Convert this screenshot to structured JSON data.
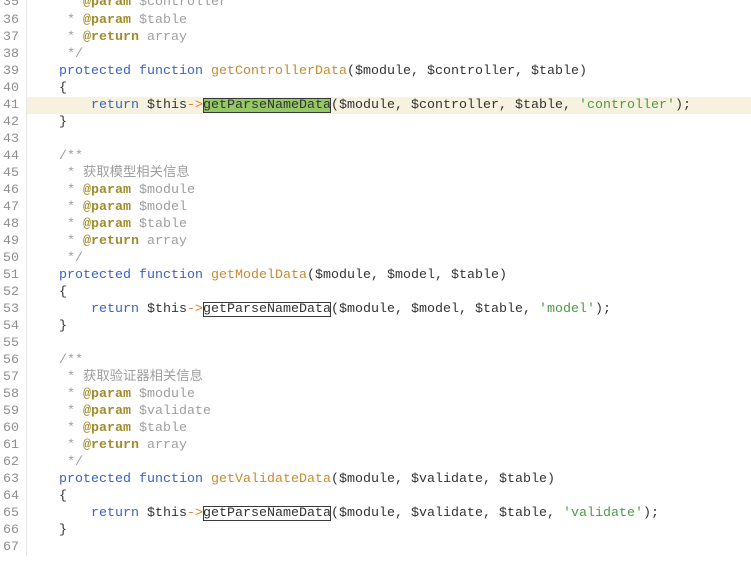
{
  "editor": {
    "colors": {
      "background": "#ffffff",
      "current_line": "#f6f2df",
      "keyword": "#3a63c4",
      "function_name": "#c8892f",
      "method_call": "#333333",
      "variable": "#333333",
      "operator": "#e07a2c",
      "punctuation": "#333333",
      "string": "#4a9c45",
      "comment": "#9e9e9e",
      "doc_tag": "#a18c2c",
      "line_number": "#8e8e8e",
      "gutter_border": "#e6e6e6",
      "selection": "#93c865",
      "selection_border": "#3a3a3a"
    },
    "lines": [
      {
        "n": "35",
        "tokens": [
          {
            "ws": "     "
          },
          {
            "cm": "* "
          },
          {
            "tag": "@param"
          },
          {
            "cm": " $controller"
          }
        ]
      },
      {
        "n": "36",
        "tokens": [
          {
            "ws": "     "
          },
          {
            "cm": "* "
          },
          {
            "tag": "@param"
          },
          {
            "cm": " $table"
          }
        ]
      },
      {
        "n": "37",
        "tokens": [
          {
            "ws": "     "
          },
          {
            "cm": "* "
          },
          {
            "tag": "@return"
          },
          {
            "cm": " array"
          }
        ]
      },
      {
        "n": "38",
        "tokens": [
          {
            "ws": "     "
          },
          {
            "cm": "*/"
          }
        ]
      },
      {
        "n": "39",
        "tokens": [
          {
            "ws": "    "
          },
          {
            "kw": "protected"
          },
          {
            "ws": " "
          },
          {
            "kw": "function"
          },
          {
            "ws": " "
          },
          {
            "fn": "getControllerData"
          },
          {
            "punc": "("
          },
          {
            "var": "$module"
          },
          {
            "punc": ", "
          },
          {
            "var": "$controller"
          },
          {
            "punc": ", "
          },
          {
            "var": "$table"
          },
          {
            "punc": ")"
          }
        ]
      },
      {
        "n": "40",
        "tokens": [
          {
            "ws": "    "
          },
          {
            "punc": "{"
          }
        ]
      },
      {
        "n": "41",
        "current": true,
        "selected": 5,
        "tokens": [
          {
            "ws": "        "
          },
          {
            "kw": "return"
          },
          {
            "ws": " "
          },
          {
            "var": "$this"
          },
          {
            "op": "->"
          },
          {
            "call": "getParseNameData"
          },
          {
            "punc": "("
          },
          {
            "var": "$module"
          },
          {
            "punc": ", "
          },
          {
            "var": "$controller"
          },
          {
            "punc": ", "
          },
          {
            "var": "$table"
          },
          {
            "punc": ", "
          },
          {
            "str": "'controller'"
          },
          {
            "punc": ");"
          }
        ]
      },
      {
        "n": "42",
        "tokens": [
          {
            "ws": "    "
          },
          {
            "punc": "}"
          }
        ]
      },
      {
        "n": "43",
        "tokens": []
      },
      {
        "n": "44",
        "tokens": [
          {
            "ws": "    "
          },
          {
            "cm": "/**"
          }
        ]
      },
      {
        "n": "45",
        "tokens": [
          {
            "ws": "     "
          },
          {
            "cm": "* 获取模型相关信息"
          }
        ]
      },
      {
        "n": "46",
        "tokens": [
          {
            "ws": "     "
          },
          {
            "cm": "* "
          },
          {
            "tag": "@param"
          },
          {
            "cm": " $module"
          }
        ]
      },
      {
        "n": "47",
        "tokens": [
          {
            "ws": "     "
          },
          {
            "cm": "* "
          },
          {
            "tag": "@param"
          },
          {
            "cm": " $model"
          }
        ]
      },
      {
        "n": "48",
        "tokens": [
          {
            "ws": "     "
          },
          {
            "cm": "* "
          },
          {
            "tag": "@param"
          },
          {
            "cm": " $table"
          }
        ]
      },
      {
        "n": "49",
        "tokens": [
          {
            "ws": "     "
          },
          {
            "cm": "* "
          },
          {
            "tag": "@return"
          },
          {
            "cm": " array"
          }
        ]
      },
      {
        "n": "50",
        "tokens": [
          {
            "ws": "     "
          },
          {
            "cm": "*/"
          }
        ]
      },
      {
        "n": "51",
        "tokens": [
          {
            "ws": "    "
          },
          {
            "kw": "protected"
          },
          {
            "ws": " "
          },
          {
            "kw": "function"
          },
          {
            "ws": " "
          },
          {
            "fn": "getModelData"
          },
          {
            "punc": "("
          },
          {
            "var": "$module"
          },
          {
            "punc": ", "
          },
          {
            "var": "$model"
          },
          {
            "punc": ", "
          },
          {
            "var": "$table"
          },
          {
            "punc": ")"
          }
        ]
      },
      {
        "n": "52",
        "tokens": [
          {
            "ws": "    "
          },
          {
            "punc": "{"
          }
        ]
      },
      {
        "n": "53",
        "occurrence": 5,
        "tokens": [
          {
            "ws": "        "
          },
          {
            "kw": "return"
          },
          {
            "ws": " "
          },
          {
            "var": "$this"
          },
          {
            "op": "->"
          },
          {
            "call": "getParseNameData"
          },
          {
            "punc": "("
          },
          {
            "var": "$module"
          },
          {
            "punc": ", "
          },
          {
            "var": "$model"
          },
          {
            "punc": ", "
          },
          {
            "var": "$table"
          },
          {
            "punc": ", "
          },
          {
            "str": "'model'"
          },
          {
            "punc": ");"
          }
        ]
      },
      {
        "n": "54",
        "tokens": [
          {
            "ws": "    "
          },
          {
            "punc": "}"
          }
        ]
      },
      {
        "n": "55",
        "tokens": []
      },
      {
        "n": "56",
        "tokens": [
          {
            "ws": "    "
          },
          {
            "cm": "/**"
          }
        ]
      },
      {
        "n": "57",
        "tokens": [
          {
            "ws": "     "
          },
          {
            "cm": "* 获取验证器相关信息"
          }
        ]
      },
      {
        "n": "58",
        "tokens": [
          {
            "ws": "     "
          },
          {
            "cm": "* "
          },
          {
            "tag": "@param"
          },
          {
            "cm": " $module"
          }
        ]
      },
      {
        "n": "59",
        "tokens": [
          {
            "ws": "     "
          },
          {
            "cm": "* "
          },
          {
            "tag": "@param"
          },
          {
            "cm": " $validate"
          }
        ]
      },
      {
        "n": "60",
        "tokens": [
          {
            "ws": "     "
          },
          {
            "cm": "* "
          },
          {
            "tag": "@param"
          },
          {
            "cm": " $table"
          }
        ]
      },
      {
        "n": "61",
        "tokens": [
          {
            "ws": "     "
          },
          {
            "cm": "* "
          },
          {
            "tag": "@return"
          },
          {
            "cm": " array"
          }
        ]
      },
      {
        "n": "62",
        "tokens": [
          {
            "ws": "     "
          },
          {
            "cm": "*/"
          }
        ]
      },
      {
        "n": "63",
        "tokens": [
          {
            "ws": "    "
          },
          {
            "kw": "protected"
          },
          {
            "ws": " "
          },
          {
            "kw": "function"
          },
          {
            "ws": " "
          },
          {
            "fn": "getValidateData"
          },
          {
            "punc": "("
          },
          {
            "var": "$module"
          },
          {
            "punc": ", "
          },
          {
            "var": "$validate"
          },
          {
            "punc": ", "
          },
          {
            "var": "$table"
          },
          {
            "punc": ")"
          }
        ]
      },
      {
        "n": "64",
        "tokens": [
          {
            "ws": "    "
          },
          {
            "punc": "{"
          }
        ]
      },
      {
        "n": "65",
        "occurrence": 5,
        "tokens": [
          {
            "ws": "        "
          },
          {
            "kw": "return"
          },
          {
            "ws": " "
          },
          {
            "var": "$this"
          },
          {
            "op": "->"
          },
          {
            "call": "getParseNameData"
          },
          {
            "punc": "("
          },
          {
            "var": "$module"
          },
          {
            "punc": ", "
          },
          {
            "var": "$validate"
          },
          {
            "punc": ", "
          },
          {
            "var": "$table"
          },
          {
            "punc": ", "
          },
          {
            "str": "'validate'"
          },
          {
            "punc": ");"
          }
        ]
      },
      {
        "n": "66",
        "tokens": [
          {
            "ws": "    "
          },
          {
            "punc": "}"
          }
        ]
      },
      {
        "n": "67",
        "tokens": []
      }
    ]
  }
}
